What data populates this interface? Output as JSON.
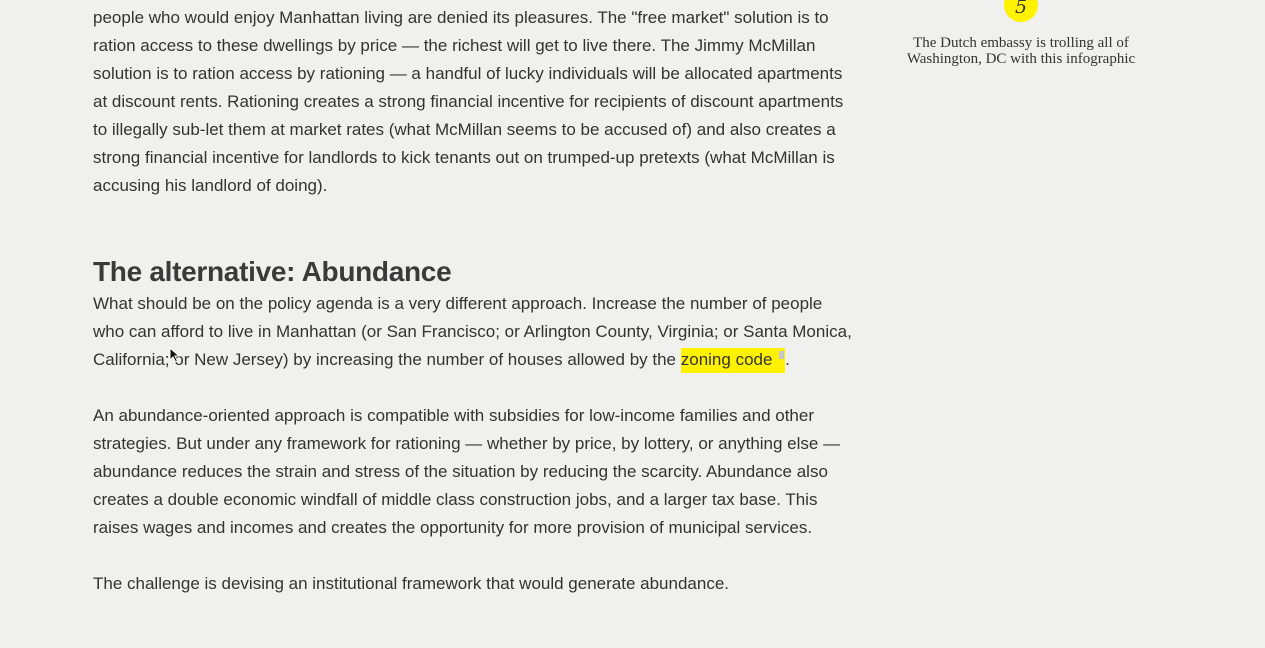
{
  "article": {
    "intro_paragraph": "people who would enjoy Manhattan living are denied its pleasures. The \"free market\" solution is to ration access to these dwellings by price — the richest will get to live there. The Jimmy McMillan solution is to ration access by rationing — a handful of lucky individuals will be allocated apartments at discount rents. Rationing creates a strong financial incentive for recipients of discount apartments to illegally sub-let them at market rates (what McMillan seems to be accused of) and also creates a strong financial incentive for landlords to kick tenants out on trumped-up pretexts (what McMillan is accusing his landlord of doing).",
    "heading": "The alternative: Abundance",
    "abundance_paragraph": "What should be on the policy agenda is a very different approach. Increase the number of people who can afford to live in Manhattan (or San Francisco; or Arlington County, Virginia; or Santa Monica, California; or New Jersey) by increasing the number of houses allowed by the ",
    "highlight_link": "zoning code",
    "after_highlight": ".",
    "approach_paragraph": "An abundance-oriented approach is compatible with subsidies for low-income families and other strategies. But under any framework for rationing — whether by price, by lottery, or anything else — abundance reduces the strain and stress of the situation by reducing the scarcity. Abundance also creates a double economic windfall of middle class construction jobs, and a larger tax base. This raises wages and incomes and creates the opportunity for more provision of municipal services.",
    "challenge_paragraph": "The challenge is devising an institutional framework that would generate abundance."
  },
  "sidebar": {
    "badge_number": "5",
    "caption": "The Dutch embassy is trolling all of Washington, DC with this infographic"
  },
  "colors": {
    "background": "#f0f1ef",
    "highlight": "#fff200",
    "text": "#333333"
  }
}
